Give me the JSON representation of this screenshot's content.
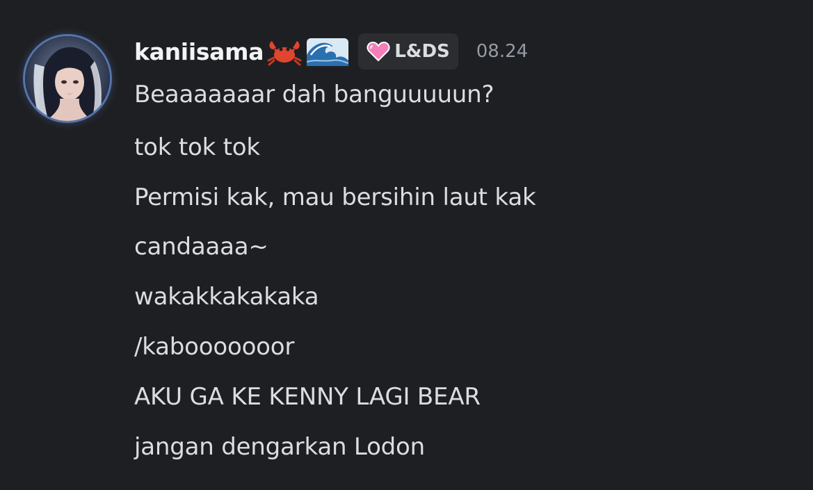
{
  "message": {
    "author": {
      "username": "kaniisama",
      "decorations": [
        "crab-emoji",
        "wave-emoji"
      ],
      "tag": {
        "icon": "pink-heart-icon",
        "label": "L&DS"
      },
      "avatar": "user-avatar"
    },
    "timestamp": "08.24",
    "lines": [
      "Beaaaaaaar dah banguuuuun?",
      "tok tok tok",
      "Permisi kak, mau bersihin laut kak",
      "candaaaa~",
      "wakakkakakaka",
      "/kabooooooor",
      "AKU GA KE KENNY LAGI BEAR",
      "jangan dengarkan Lodon"
    ]
  },
  "colors": {
    "background": "#1e1f22",
    "text": "#dbdee1",
    "username": "#f2f3f5",
    "timestamp": "#949ba4",
    "tag_background": "#2b2d31",
    "tag_heart": "#f47fba"
  }
}
